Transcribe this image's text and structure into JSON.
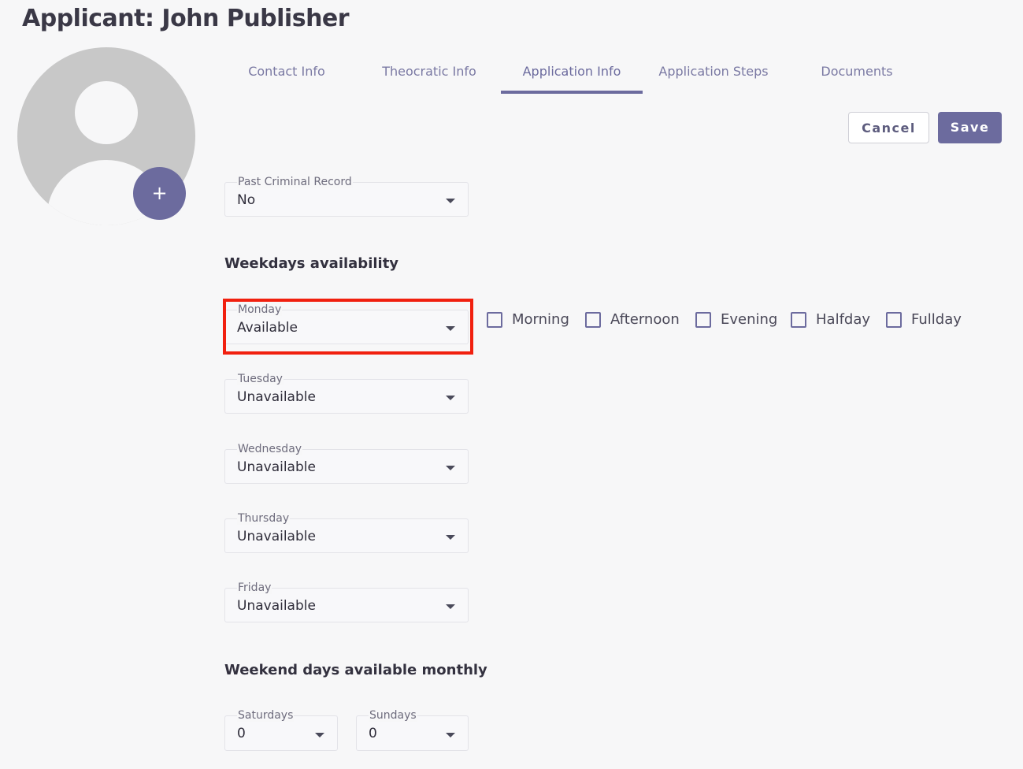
{
  "header": {
    "title": "Applicant: John Publisher"
  },
  "avatar": {
    "add_label": "+"
  },
  "tabs": [
    {
      "label": "Contact Info"
    },
    {
      "label": "Theocratic Info"
    },
    {
      "label": "Application Info",
      "active": true
    },
    {
      "label": "Application Steps"
    },
    {
      "label": "Documents"
    }
  ],
  "actions": {
    "cancel": "Cancel",
    "save": "Save"
  },
  "criminal_record": {
    "label": "Past Criminal Record",
    "value": "No"
  },
  "weekdays": {
    "title": "Weekdays availability",
    "monday": {
      "label": "Monday",
      "value": "Available"
    },
    "tuesday": {
      "label": "Tuesday",
      "value": "Unavailable"
    },
    "wednesday": {
      "label": "Wednesday",
      "value": "Unavailable"
    },
    "thursday": {
      "label": "Thursday",
      "value": "Unavailable"
    },
    "friday": {
      "label": "Friday",
      "value": "Unavailable"
    },
    "monday_slots": [
      {
        "label": "Morning",
        "checked": false
      },
      {
        "label": "Afternoon",
        "checked": false
      },
      {
        "label": "Evening",
        "checked": false
      },
      {
        "label": "Halfday",
        "checked": false
      },
      {
        "label": "Fullday",
        "checked": false
      }
    ]
  },
  "weekend": {
    "title": "Weekend days available monthly",
    "saturdays": {
      "label": "Saturdays",
      "value": "0"
    },
    "sundays": {
      "label": "Sundays",
      "value": "0"
    }
  },
  "colors": {
    "accent": "#6c6b9e",
    "highlight": "#f1200f"
  }
}
